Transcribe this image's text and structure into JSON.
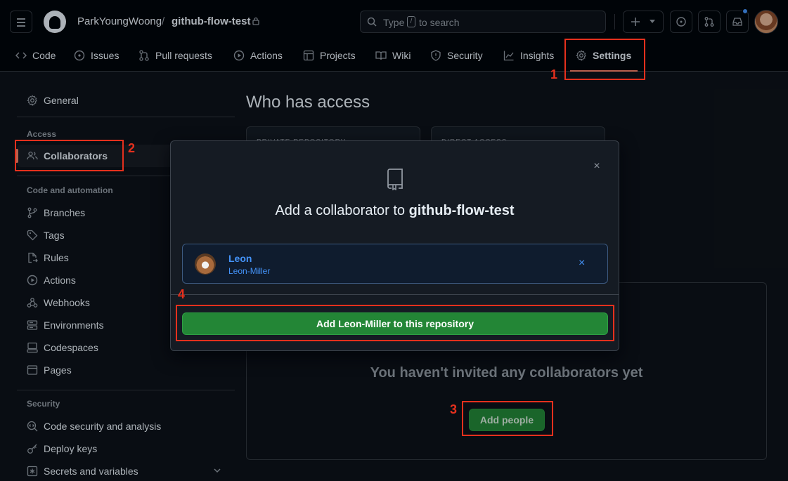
{
  "header": {
    "owner": "ParkYoungWoong",
    "separator": "/",
    "repo": "github-flow-test",
    "search_prefix": "Type",
    "search_key": "/",
    "search_suffix": "to search"
  },
  "tabs": [
    {
      "label": "Code",
      "icon": "code-icon"
    },
    {
      "label": "Issues",
      "icon": "issue-icon"
    },
    {
      "label": "Pull requests",
      "icon": "pull-request-icon"
    },
    {
      "label": "Actions",
      "icon": "play-icon"
    },
    {
      "label": "Projects",
      "icon": "table-icon"
    },
    {
      "label": "Wiki",
      "icon": "book-icon"
    },
    {
      "label": "Security",
      "icon": "shield-icon"
    },
    {
      "label": "Insights",
      "icon": "graph-icon"
    },
    {
      "label": "Settings",
      "icon": "gear-icon",
      "active": true
    }
  ],
  "sidebar": {
    "general": "General",
    "access_heading": "Access",
    "collaborators": "Collaborators",
    "code_heading": "Code and automation",
    "code_items": [
      "Branches",
      "Tags",
      "Rules",
      "Actions",
      "Webhooks",
      "Environments",
      "Codespaces",
      "Pages"
    ],
    "security_heading": "Security",
    "security_items": [
      "Code security and analysis",
      "Deploy keys",
      "Secrets and variables"
    ]
  },
  "main": {
    "title": "Who has access",
    "card1_label": "PRIVATE REPOSITORY",
    "card2_label": "DIRECT ACCESS",
    "empty_message": "You haven't invited any collaborators yet",
    "add_people": "Add people"
  },
  "dialog": {
    "title_prefix": "Add a collaborator to",
    "title_repo": "github-flow-test",
    "user_name": "Leon",
    "user_login": "Leon-Miller",
    "remove": "×",
    "close": "×",
    "add_button": "Add Leon-Miller to this repository"
  },
  "annotations": [
    "1",
    "2",
    "3",
    "4"
  ],
  "colors": {
    "annotation": "#e5301d",
    "primary_button": "#238636",
    "link": "#4493f8",
    "tab_underline": "#f78166"
  }
}
